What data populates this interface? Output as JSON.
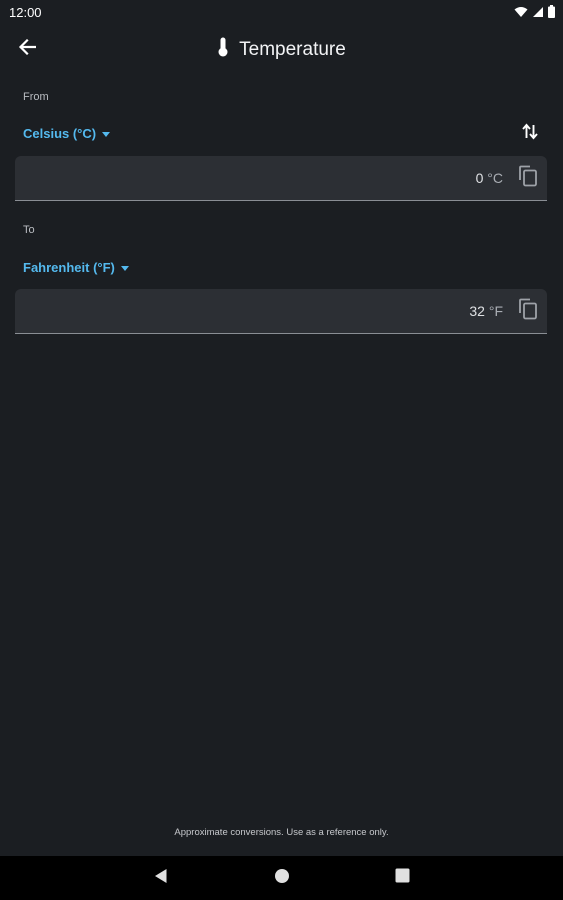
{
  "status_bar": {
    "time": "12:00",
    "icons": [
      "wifi-icon",
      "signal-icon",
      "battery-icon"
    ]
  },
  "app_bar": {
    "back_icon": "arrow-back-icon",
    "title_icon": "thermometer-icon",
    "title": "Temperature"
  },
  "from": {
    "label": "From",
    "unit_label": "Celsius (°C)",
    "value": "0",
    "unit_symbol": "°C"
  },
  "to": {
    "label": "To",
    "unit_label": "Fahrenheit (°F)",
    "value": "32",
    "unit_symbol": "°F"
  },
  "swap_icon": "swap-vertical-icon",
  "copy_icon": "copy-icon",
  "footer": {
    "note": "Approximate conversions. Use as a reference only."
  },
  "nav_bar": {
    "buttons": [
      "back-triangle-icon",
      "home-circle-icon",
      "recents-square-icon"
    ]
  },
  "colors": {
    "background": "#1b1e22",
    "field": "#2c2f34",
    "accent": "#54b9ee"
  }
}
